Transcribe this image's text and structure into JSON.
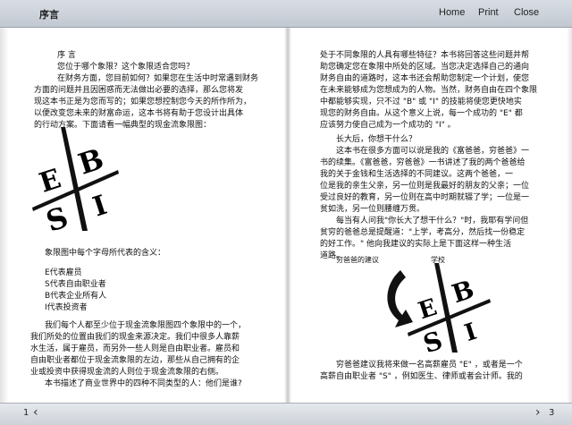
{
  "toolbar": {
    "title": "序言",
    "home_label": "Home",
    "print_label": "Print",
    "close_label": "Close"
  },
  "left_page": {
    "heading": "序  言",
    "lines": [
      "您位于哪个象限？这个象限适合您吗？",
      "在财务方面，您目前如何？如果您在生活中时常遇到财务",
      "方面的问题并且因困惑而无法做出必要的选择，那么您将发",
      "现这本书正是为您而写的；如果您想控制您今天的所作所为，",
      "以便改变您未来的财富命运，这本书将有助于您设计出具体",
      "的行动方案。下面请看一幅典型的现金流象限图："
    ],
    "quadrant_caption": "象限图中每个字母所代表的含义：",
    "legend": [
      "E代表雇员",
      "S代表自由职业者",
      "B代表企业所有人",
      "I代表投资者"
    ],
    "bottom_lines": [
      "我们每个人都至少位于现金流象限图四个象限中的一个，",
      "我们所处的位置由我们的现金来源决定。我们中很多人靠薪",
      "水生活，属于雇员，而另外一些人则是自由职业者。雇员和",
      "自由职业者都位于现金流象限的左边，那些从自己拥有的企",
      "业或投资中获得现金流的人则位于现金流象限的右侧。",
      "本书描述了商业世界中的四种不同类型的人：他们是谁?"
    ],
    "page_number": "1"
  },
  "right_page": {
    "top_lines": [
      "处于不同象限的人具有哪些特征？本书将回答这些问题并帮",
      "助您确定您在象限中所处的区域。当您决定选择自己的通向",
      "财务自由的道路时，这本书还会帮助您制定一个计划，使您",
      "在未来能够成为您想成为的人物。当然，财务自由在四个象限",
      "中都能够实现，只不过 \"B\" 或 \"I\" 的技能将使您更快地实",
      "现您的财务自由。从这个意义上说，每一个成功的 \"E\" 都",
      "应该努力使自己成为一个成功的 \"I\" 。"
    ],
    "mid_lines": [
      "长大后，你想干什么？",
      "这本书在很多方面可以说是我的《富爸爸，穷爸爸》一",
      "书的续集。《富爸爸，穷爸爸》一书讲述了我的两个爸爸给",
      "我的关于金钱和生活选择的不同建议。这两个爸爸，一",
      "位是我的亲生父亲，另一位则是我最好的朋友的父亲；一位",
      "受过良好的教育，另一位则在高中时期就辍了学；一位是一",
      "贫如洗，另一位则腰缠万贯。",
      "每当有人问我\"你长大了想干什么？\"时，我耶有学问但",
      "贫穷的爸爸总是提醒道：\"上学，考高分，然后找一份稳定",
      "的好工作。\"   他向我建议的实际上是下面这样一种生活",
      "道路。"
    ],
    "diagram_label_left": "穷爸爸的建议",
    "diagram_label_right": "学校",
    "bottom_lines": [
      "穷爸爸建议我将来做一名高薪雇员 \"E\" ，或者是一个",
      "高薪自由职业者 \"S\" ，例如医生、律师或者会计师。我的"
    ],
    "page_number": "3"
  },
  "emblem_letters": {
    "e": "E",
    "b": "B",
    "s": "S",
    "i": "I"
  },
  "footer": {
    "prev_arrow": "‹",
    "next_arrow": "›"
  }
}
